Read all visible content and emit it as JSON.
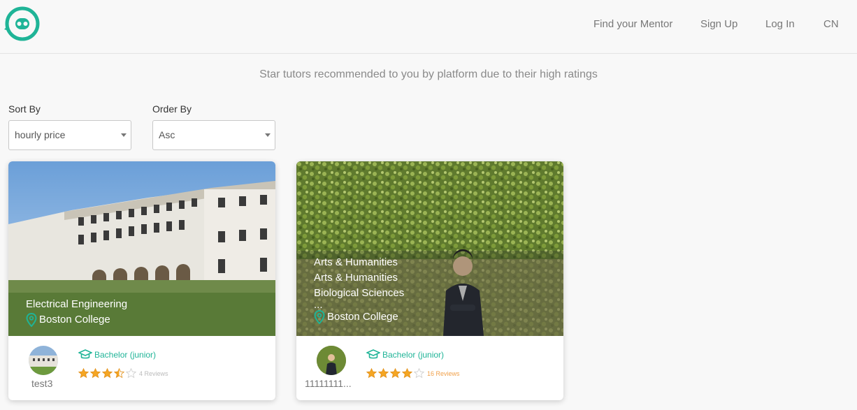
{
  "header": {
    "nav": [
      "Find your Mentor",
      "Sign Up",
      "Log In",
      "CN"
    ]
  },
  "headline": "Star tutors recommended to you by platform due to their high ratings",
  "filters": {
    "sort_label": "Sort By",
    "sort_value": "hourly price",
    "order_label": "Order By",
    "order_value": "Asc"
  },
  "colors": {
    "accent": "#1fb497",
    "star": "#f5a623",
    "star_empty": "#cccccc"
  },
  "cards": [
    {
      "subjects": [
        "Electrical Engineering"
      ],
      "school": "Boston College",
      "degree": "Bachelor (junior)",
      "name": "test3",
      "rating": 3.5,
      "reviews": "4 Reviews"
    },
    {
      "subjects": [
        "Arts & Humanities",
        "Arts & Humanities",
        "Biological Sciences",
        "..."
      ],
      "school": "Boston College",
      "degree": "Bachelor (junior)",
      "name": "11111111...",
      "rating": 4,
      "reviews": "16 Reviews"
    }
  ]
}
